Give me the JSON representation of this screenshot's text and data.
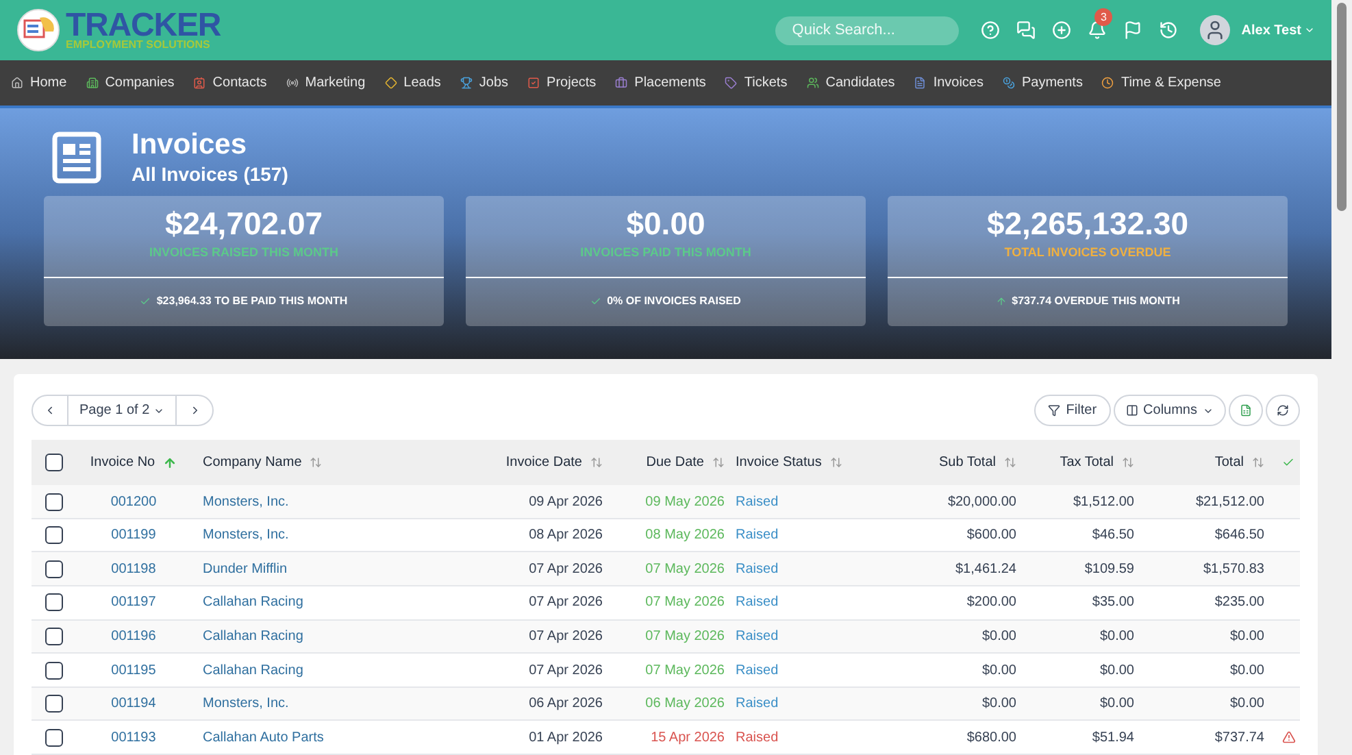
{
  "header": {
    "logo_title": "TRACKER",
    "logo_subtitle": "EMPLOYMENT SOLUTIONS",
    "search": {
      "placeholder": "Quick Search..."
    },
    "notification_count": "3",
    "user": "Alex Test"
  },
  "nav": [
    {
      "label": "Home",
      "color": "#bbbbbb"
    },
    {
      "label": "Companies",
      "color": "#5cb85c"
    },
    {
      "label": "Contacts",
      "color": "#e05a4a"
    },
    {
      "label": "Marketing",
      "color": "#bbbbbb"
    },
    {
      "label": "Leads",
      "color": "#e8b730"
    },
    {
      "label": "Jobs",
      "color": "#4aa3df"
    },
    {
      "label": "Projects",
      "color": "#e05a4a"
    },
    {
      "label": "Placements",
      "color": "#9b7fd1"
    },
    {
      "label": "Tickets",
      "color": "#9b7fd1"
    },
    {
      "label": "Candidates",
      "color": "#5cb85c"
    },
    {
      "label": "Invoices",
      "color": "#6f8fd8"
    },
    {
      "label": "Payments",
      "color": "#4aa3df"
    },
    {
      "label": "Time & Expense",
      "color": "#f0a040"
    }
  ],
  "page": {
    "title": "Invoices",
    "subtitle": "All Invoices (157)"
  },
  "stats": [
    {
      "value": "$24,702.07",
      "label": "INVOICES RAISED THIS MONTH",
      "color": "#5cc98a",
      "footer": "$23,964.33 TO BE PAID THIS MONTH"
    },
    {
      "value": "$0.00",
      "label": "INVOICES PAID THIS MONTH",
      "color": "#5cc98a",
      "footer": "0% OF INVOICES RAISED"
    },
    {
      "value": "$2,265,132.30",
      "label": "TOTAL INVOICES OVERDUE",
      "color": "#f0b040",
      "footer": "$737.74 OVERDUE THIS MONTH"
    }
  ],
  "pager": {
    "label": "Page 1 of 2"
  },
  "toolbar": {
    "filter": "Filter",
    "columns": "Columns"
  },
  "table": {
    "select_all_checked": false,
    "columns": [
      {
        "label": "Invoice No",
        "sorted": true
      },
      {
        "label": "Company Name",
        "sorted": false
      },
      {
        "label": "Invoice Date",
        "sorted": false
      },
      {
        "label": "Due Date",
        "sorted": false
      },
      {
        "label": "Invoice Status",
        "sorted": false
      },
      {
        "label": "Sub Total",
        "sorted": false
      },
      {
        "label": "Tax Total",
        "sorted": false
      },
      {
        "label": "Total",
        "sorted": false
      }
    ],
    "rows": [
      {
        "checked": false,
        "overdue": false,
        "cells": [
          "001200",
          "Monsters, Inc.",
          "09 Apr 2026",
          "09 May 2026",
          "Raised",
          "$20,000.00",
          "$1,512.00",
          "$21,512.00"
        ]
      },
      {
        "checked": false,
        "overdue": false,
        "cells": [
          "001199",
          "Monsters, Inc.",
          "08 Apr 2026",
          "08 May 2026",
          "Raised",
          "$600.00",
          "$46.50",
          "$646.50"
        ]
      },
      {
        "checked": false,
        "overdue": false,
        "cells": [
          "001198",
          "Dunder Mifflin",
          "07 Apr 2026",
          "07 May 2026",
          "Raised",
          "$1,461.24",
          "$109.59",
          "$1,570.83"
        ]
      },
      {
        "checked": false,
        "overdue": false,
        "cells": [
          "001197",
          "Callahan Racing",
          "07 Apr 2026",
          "07 May 2026",
          "Raised",
          "$200.00",
          "$35.00",
          "$235.00"
        ]
      },
      {
        "checked": false,
        "overdue": false,
        "cells": [
          "001196",
          "Callahan Racing",
          "07 Apr 2026",
          "07 May 2026",
          "Raised",
          "$0.00",
          "$0.00",
          "$0.00"
        ]
      },
      {
        "checked": false,
        "overdue": false,
        "cells": [
          "001195",
          "Callahan Racing",
          "07 Apr 2026",
          "07 May 2026",
          "Raised",
          "$0.00",
          "$0.00",
          "$0.00"
        ]
      },
      {
        "checked": false,
        "overdue": false,
        "cells": [
          "001194",
          "Monsters, Inc.",
          "06 Apr 2026",
          "06 May 2026",
          "Raised",
          "$0.00",
          "$0.00",
          "$0.00"
        ]
      },
      {
        "checked": false,
        "overdue": true,
        "cells": [
          "001193",
          "Callahan Auto Parts",
          "01 Apr 2026",
          "15 Apr 2026",
          "Raised",
          "$680.00",
          "$51.94",
          "$737.74"
        ]
      }
    ]
  }
}
